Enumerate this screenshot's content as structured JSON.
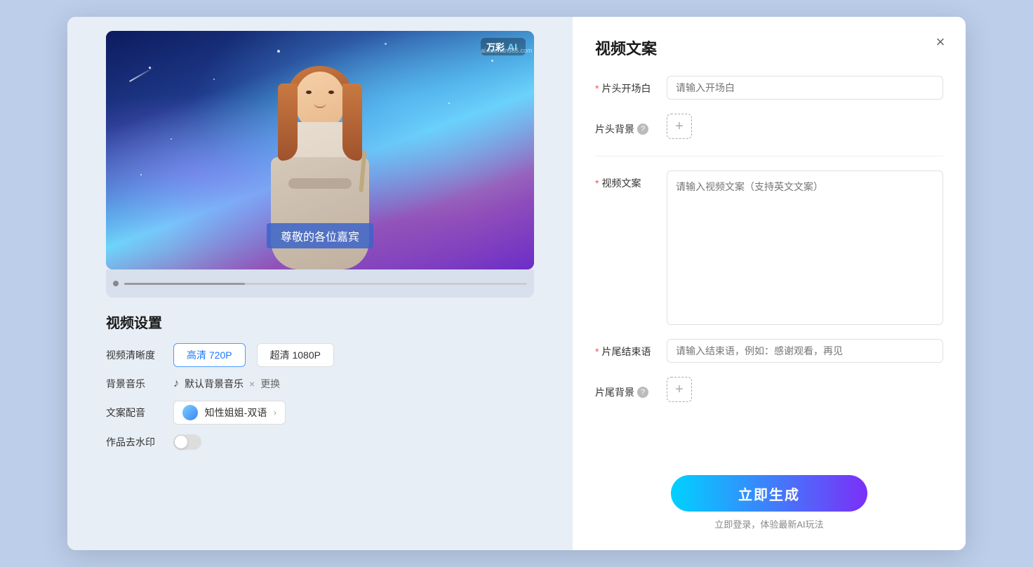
{
  "modal": {
    "close_label": "×"
  },
  "left": {
    "watermark": {
      "brand": "万彩",
      "ai": "AI",
      "url": "ai.keehan365.com"
    },
    "subtitle": "尊敬的各位嘉宾",
    "settings_title": "视频设置",
    "rows": [
      {
        "label": "视频清晰度",
        "type": "quality",
        "options": [
          "高清 720P",
          "超清 1080P"
        ],
        "active": 0
      },
      {
        "label": "背景音乐",
        "type": "music",
        "music_name": "默认背景音乐",
        "change_label": "更换"
      },
      {
        "label": "文案配音",
        "type": "voice",
        "voice_name": "知性姐姐-双语"
      },
      {
        "label": "作品去水印",
        "type": "toggle",
        "value": false
      }
    ]
  },
  "right": {
    "title": "视频文案",
    "fields": [
      {
        "id": "opening",
        "label": "片头开场白",
        "required": true,
        "type": "input",
        "placeholder": "请输入开场白"
      },
      {
        "id": "header_bg",
        "label": "片头背景",
        "required": false,
        "type": "add",
        "has_help": true
      },
      {
        "id": "video_copy",
        "label": "视频文案",
        "required": true,
        "type": "textarea",
        "placeholder": "请输入视频文案（支持英文文案）"
      },
      {
        "id": "closing",
        "label": "片尾结束语",
        "required": true,
        "type": "input",
        "placeholder": "请输入结束语，例如：感谢观看，再见"
      },
      {
        "id": "footer_bg",
        "label": "片尾背景",
        "required": false,
        "type": "add",
        "has_help": true
      }
    ],
    "generate_btn": "立即生成",
    "generate_hint": "立即登录，体验最新AI玩法"
  }
}
